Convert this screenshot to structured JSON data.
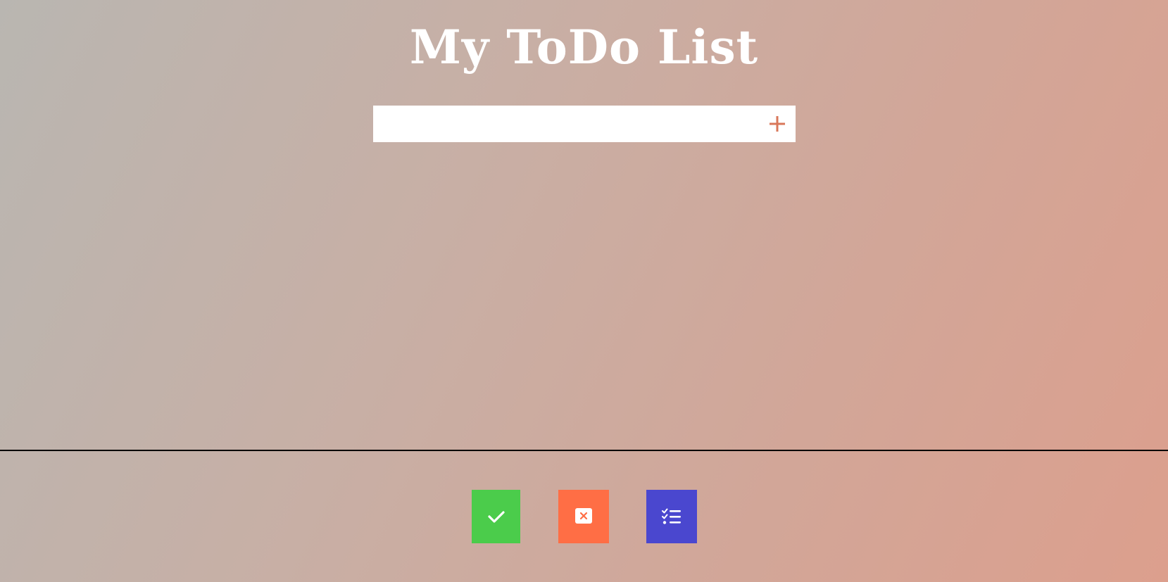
{
  "app": {
    "title": "My ToDo List"
  },
  "input": {
    "value": "",
    "placeholder": "",
    "add_icon": "plus-icon",
    "accent_color": "#d9775a"
  },
  "todos": [],
  "filters": [
    {
      "icon": "check-icon",
      "color": "#4bcc4b"
    },
    {
      "icon": "close-box-icon",
      "color": "#ff6e45"
    },
    {
      "icon": "checklist-icon",
      "color": "#4a47cf"
    }
  ]
}
